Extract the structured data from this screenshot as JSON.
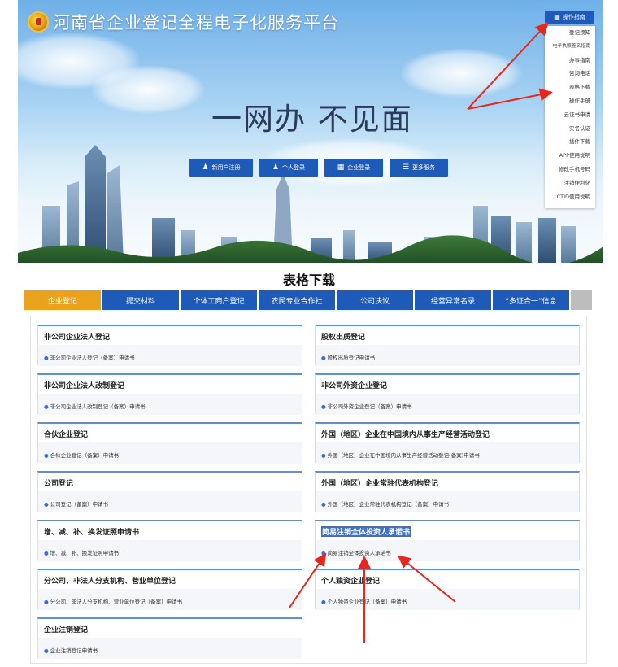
{
  "header": {
    "site_title": "河南省企业登记全程电子化服务平台",
    "slogan": "一网办  不见面",
    "ops_button": "操作指南"
  },
  "hero_buttons": [
    {
      "label": "新用户注册",
      "icon": "user-plus-icon"
    },
    {
      "label": "个人登录",
      "icon": "user-icon"
    },
    {
      "label": "企业登录",
      "icon": "building-icon"
    },
    {
      "label": "更多服务",
      "icon": "list-icon"
    }
  ],
  "ops_menu": [
    "登记须知",
    "电子执照签名指南",
    "办事指南",
    "咨询电话",
    "表格下载",
    "操作手册",
    "云证书申请",
    "实名认证",
    "插件下载",
    "APP使用说明",
    "修改手机号码",
    "注销便利化",
    "CTID使用说明"
  ],
  "section_title": "表格下载",
  "tabs": [
    "企业登记",
    "提交材料",
    "个体工商户登记",
    "农民专业合作社",
    "公司决议",
    "经营异常名录",
    "“多证合一”信息",
    ""
  ],
  "cards": [
    {
      "title": "非公司企业法人登记",
      "item": "非公司企业法人登记（备案）申请书"
    },
    {
      "title": "股权出质登记",
      "item": "股权出质登记申请书"
    },
    {
      "title": "非公司企业法人改制登记",
      "item": "非公司企业法人改制登记（备案）申请书"
    },
    {
      "title": "非公司外资企业登记",
      "item": "非公司外资企业登记（备案）申请书"
    },
    {
      "title": "合伙企业登记",
      "item": "合伙企业登记（备案）申请书"
    },
    {
      "title": "外国（地区）企业在中国境内从事生产经营活动登记",
      "item": "外国（地区）企业在中国境内从事生产经营活动登记(备案)申请书"
    },
    {
      "title": "公司登记",
      "item": "公司登记（备案）申请书"
    },
    {
      "title": "外国（地区）企业常驻代表机构登记",
      "item": "外国（地区）企业常驻代表机构登记（备案）申请书"
    },
    {
      "title": "增、减、补、换发证照申请书",
      "item": "增、减、补、换发证照申请书"
    },
    {
      "title": "简易注销全体投资人承诺书",
      "item": "简易注销全体投资人承诺书"
    },
    {
      "title": "分公司、非法人分支机构、营业单位登记",
      "item": "分公司、非法人分支机构、营业单位登记（备案）申请书"
    },
    {
      "title": "个人独资企业登记",
      "item": "个人独资企业登记（备案）申请书"
    },
    {
      "title": "企业注销登记",
      "item": "企业注销登记申请书"
    }
  ],
  "colors": {
    "brand_blue": "#1e5bb8",
    "active_tab": "#eaa21d",
    "annotation_red": "#e8261c"
  }
}
